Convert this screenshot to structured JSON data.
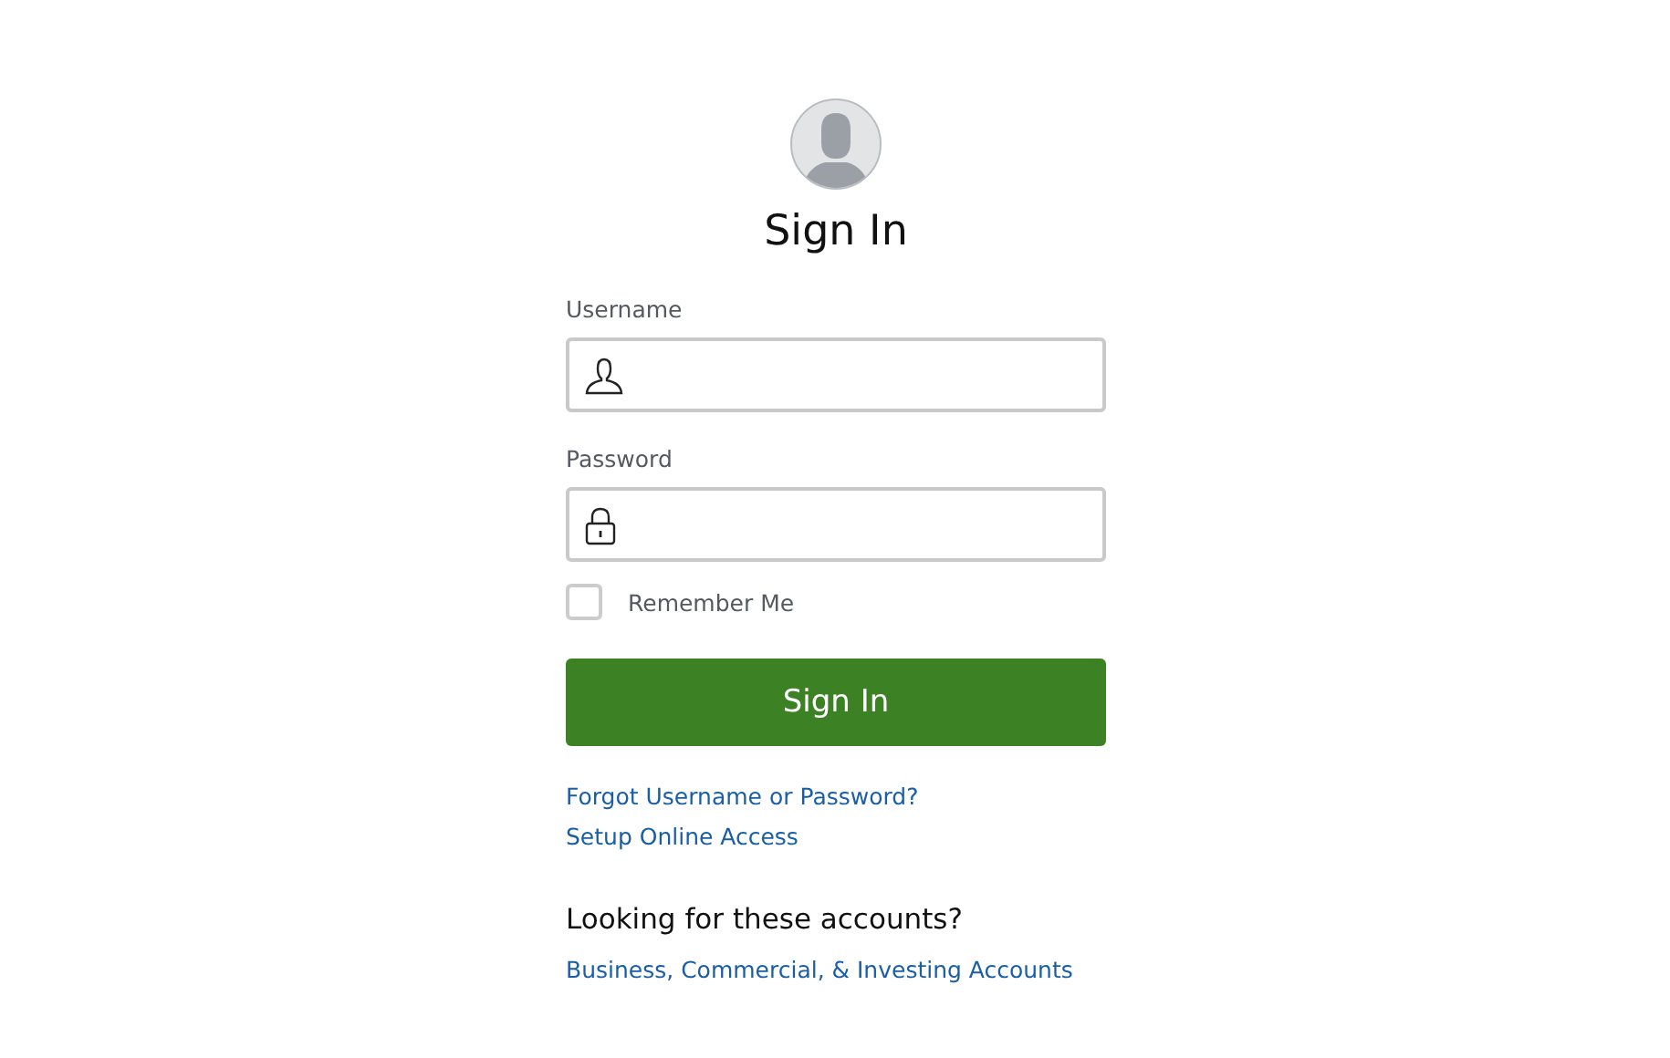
{
  "title": "Sign In",
  "fields": [
    {
      "label": "Username",
      "kind": "user"
    },
    {
      "label": "Password",
      "kind": "lock"
    }
  ],
  "remember": {
    "label": "Remember Me",
    "checked": false
  },
  "submit": "Sign In",
  "links": [
    "Forgot Username or Password?",
    "Setup Online Access"
  ],
  "other": {
    "heading": "Looking for these accounts?",
    "link": "Business, Commercial, & Investing Accounts"
  }
}
